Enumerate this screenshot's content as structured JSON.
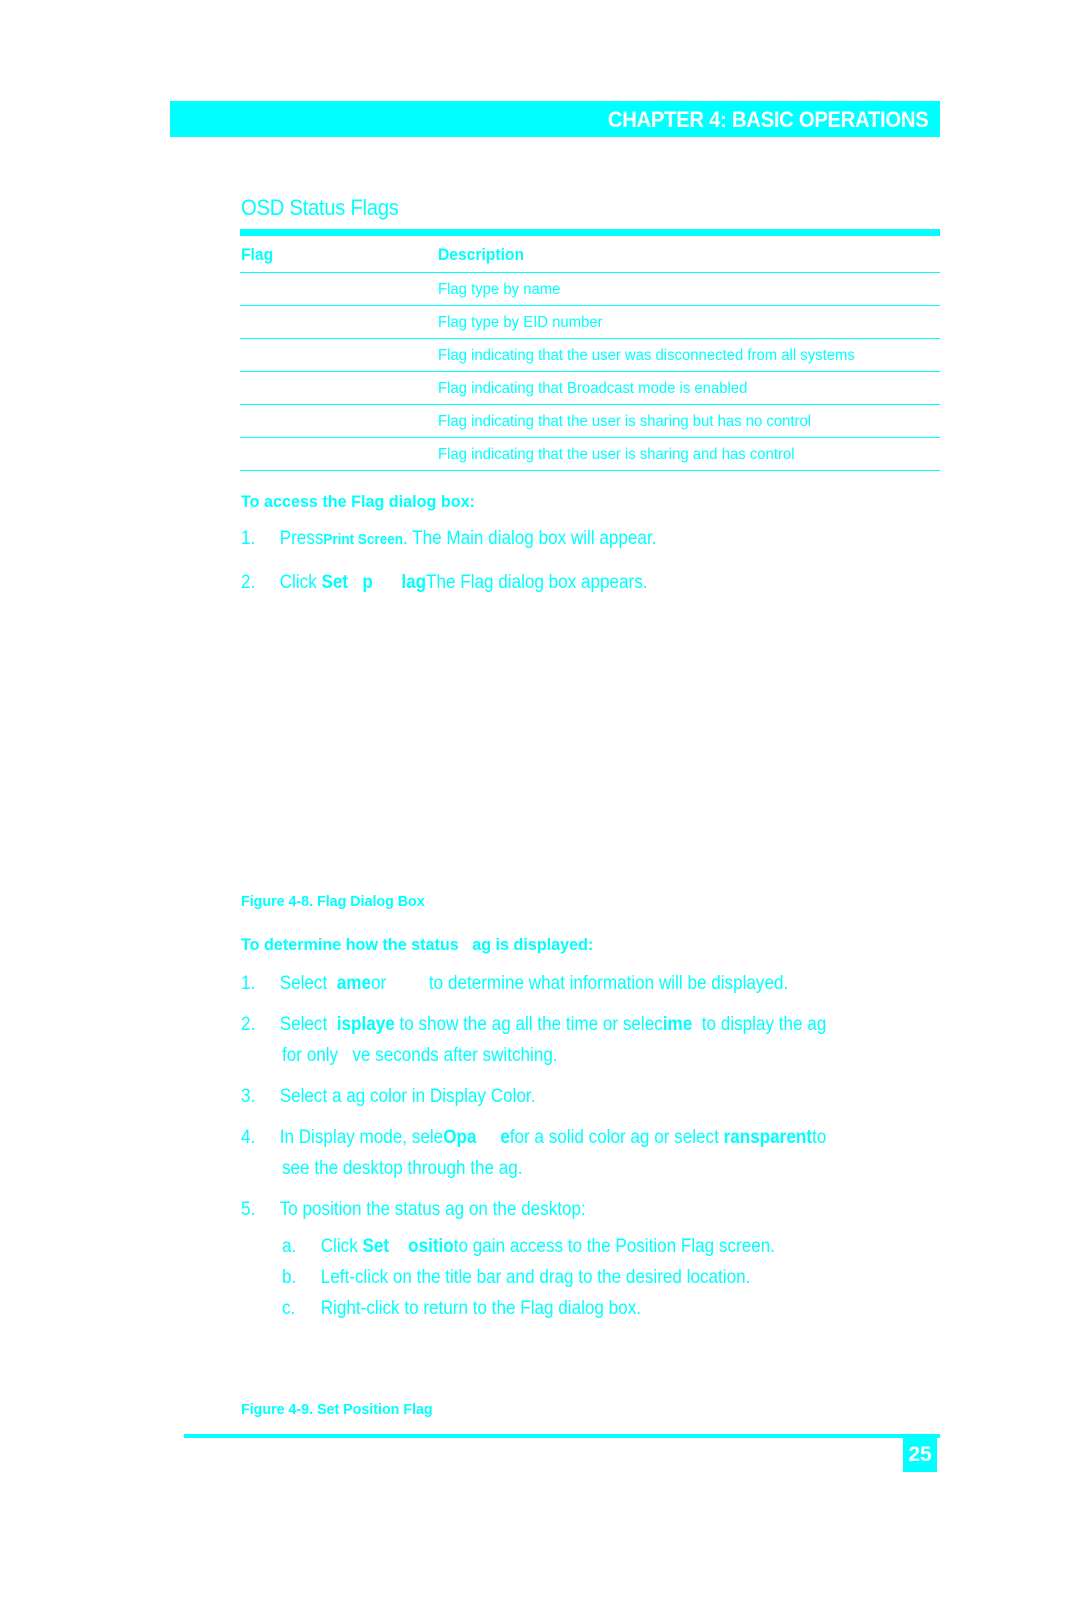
{
  "header": {
    "chapter_title": "CHAPTER 4: BASIC OPERATIONS"
  },
  "section": {
    "title": "OSD Status Flags"
  },
  "flags_table": {
    "headers": [
      "Flag",
      "Description"
    ],
    "rows": [
      {
        "flag": "",
        "description": "Flag type by name"
      },
      {
        "flag": "",
        "description": "Flag type by EID number"
      },
      {
        "flag": "",
        "description": "Flag indicating that the user was disconnected from all systems"
      },
      {
        "flag": "",
        "description": "Flag indicating that Broadcast mode is enabled"
      },
      {
        "flag": "",
        "description": "Flag indicating that the user is sharing but has no control"
      },
      {
        "flag": "",
        "description": "Flag indicating that the user is sharing and has control"
      }
    ]
  },
  "access_procedure": {
    "heading": "To access the Flag dialog box:",
    "steps": [
      {
        "num": "1.",
        "pre": "Press",
        "bold": "Print Screen",
        "post": ". The Main dialog box will appear."
      },
      {
        "num": "2.",
        "pre": "Click ",
        "bold": "Set   p      lag",
        "post": "The Flag dialog box appears."
      }
    ]
  },
  "figure_8": {
    "caption": "Figure 4-8. Flag Dialog Box"
  },
  "display_procedure": {
    "heading": "To determine how the status   ag is displayed:",
    "steps": [
      {
        "num": "1.",
        "parts": [
          {
            "t": "Select  ",
            "b": false
          },
          {
            "t": "ame",
            "b": true
          },
          {
            "t": "or         to determine what information will be displayed.",
            "b": false
          }
        ]
      },
      {
        "num": "2.",
        "parts": [
          {
            "t": "Select  ",
            "b": false
          },
          {
            "t": "isplaye",
            "b": true
          },
          {
            "t": " to show the ag all the time or selec",
            "b": false
          },
          {
            "t": "ime",
            "b": true
          },
          {
            "t": "  to display the ag",
            "b": false
          }
        ],
        "continuation": "for only   ve seconds after switching."
      },
      {
        "num": "3.",
        "parts": [
          {
            "t": "Select a ag color in Display Color.",
            "b": false
          }
        ]
      },
      {
        "num": "4.",
        "parts": [
          {
            "t": "In Display mode, sele",
            "b": false
          },
          {
            "t": "Opa     e",
            "b": true
          },
          {
            "t": "for a solid color ag or select ",
            "b": false
          },
          {
            "t": "ransparent",
            "b": true
          },
          {
            "t": "to",
            "b": false
          }
        ],
        "continuation": "see the desktop through the ag."
      },
      {
        "num": "5.",
        "parts": [
          {
            "t": "To position the status ag on the desktop:",
            "b": false
          }
        ]
      }
    ],
    "substeps": [
      {
        "num": "a.",
        "parts": [
          {
            "t": "Click ",
            "b": false
          },
          {
            "t": "Set    ositio",
            "b": true
          },
          {
            "t": "to gain access to the Position Flag screen.",
            "b": false
          }
        ]
      },
      {
        "num": "b.",
        "parts": [
          {
            "t": "Left-click on the title bar and drag to the desired location.",
            "b": false
          }
        ]
      },
      {
        "num": "c.",
        "parts": [
          {
            "t": "Right-click to return to the Flag dialog box.",
            "b": false
          }
        ]
      }
    ]
  },
  "figure_9": {
    "caption": "Figure 4-9. Set Position Flag"
  },
  "footer": {
    "page_number": "25"
  },
  "colors": {
    "accent": "#00ffff",
    "background": "#ffffff",
    "header_text": "#ffffff"
  }
}
